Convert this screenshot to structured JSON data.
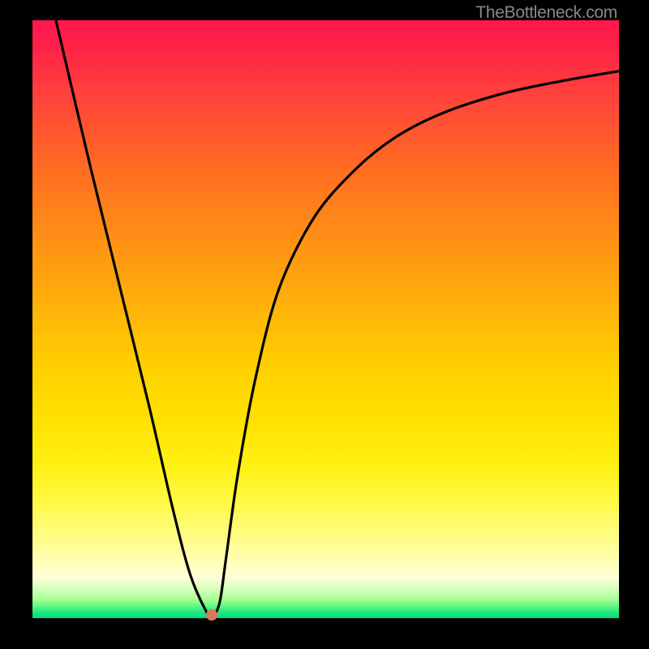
{
  "watermark": "TheBottleneck.com",
  "chart_data": {
    "type": "line",
    "title": "",
    "xlabel": "",
    "ylabel": "",
    "xlim": [
      0,
      100
    ],
    "ylim": [
      0,
      100
    ],
    "grid": false,
    "series": [
      {
        "name": "curve",
        "x": [
          4,
          10,
          15,
          20,
          24,
          27,
          30,
          31,
          32,
          33,
          35,
          38,
          42,
          48,
          55,
          62,
          70,
          80,
          90,
          100
        ],
        "values": [
          100,
          75,
          55,
          35,
          18,
          7,
          0.5,
          0.5,
          3,
          10,
          24,
          40,
          55,
          67,
          75,
          80.5,
          84.5,
          87.7,
          89.8,
          91.5
        ]
      }
    ],
    "minimum_point": {
      "x": 30.5,
      "y": 0.5
    },
    "colors": {
      "background_top": "#ff1850",
      "background_bottom": "#00d880",
      "curve": "#000000",
      "frame": "#000000",
      "dot": "#d67860"
    }
  }
}
